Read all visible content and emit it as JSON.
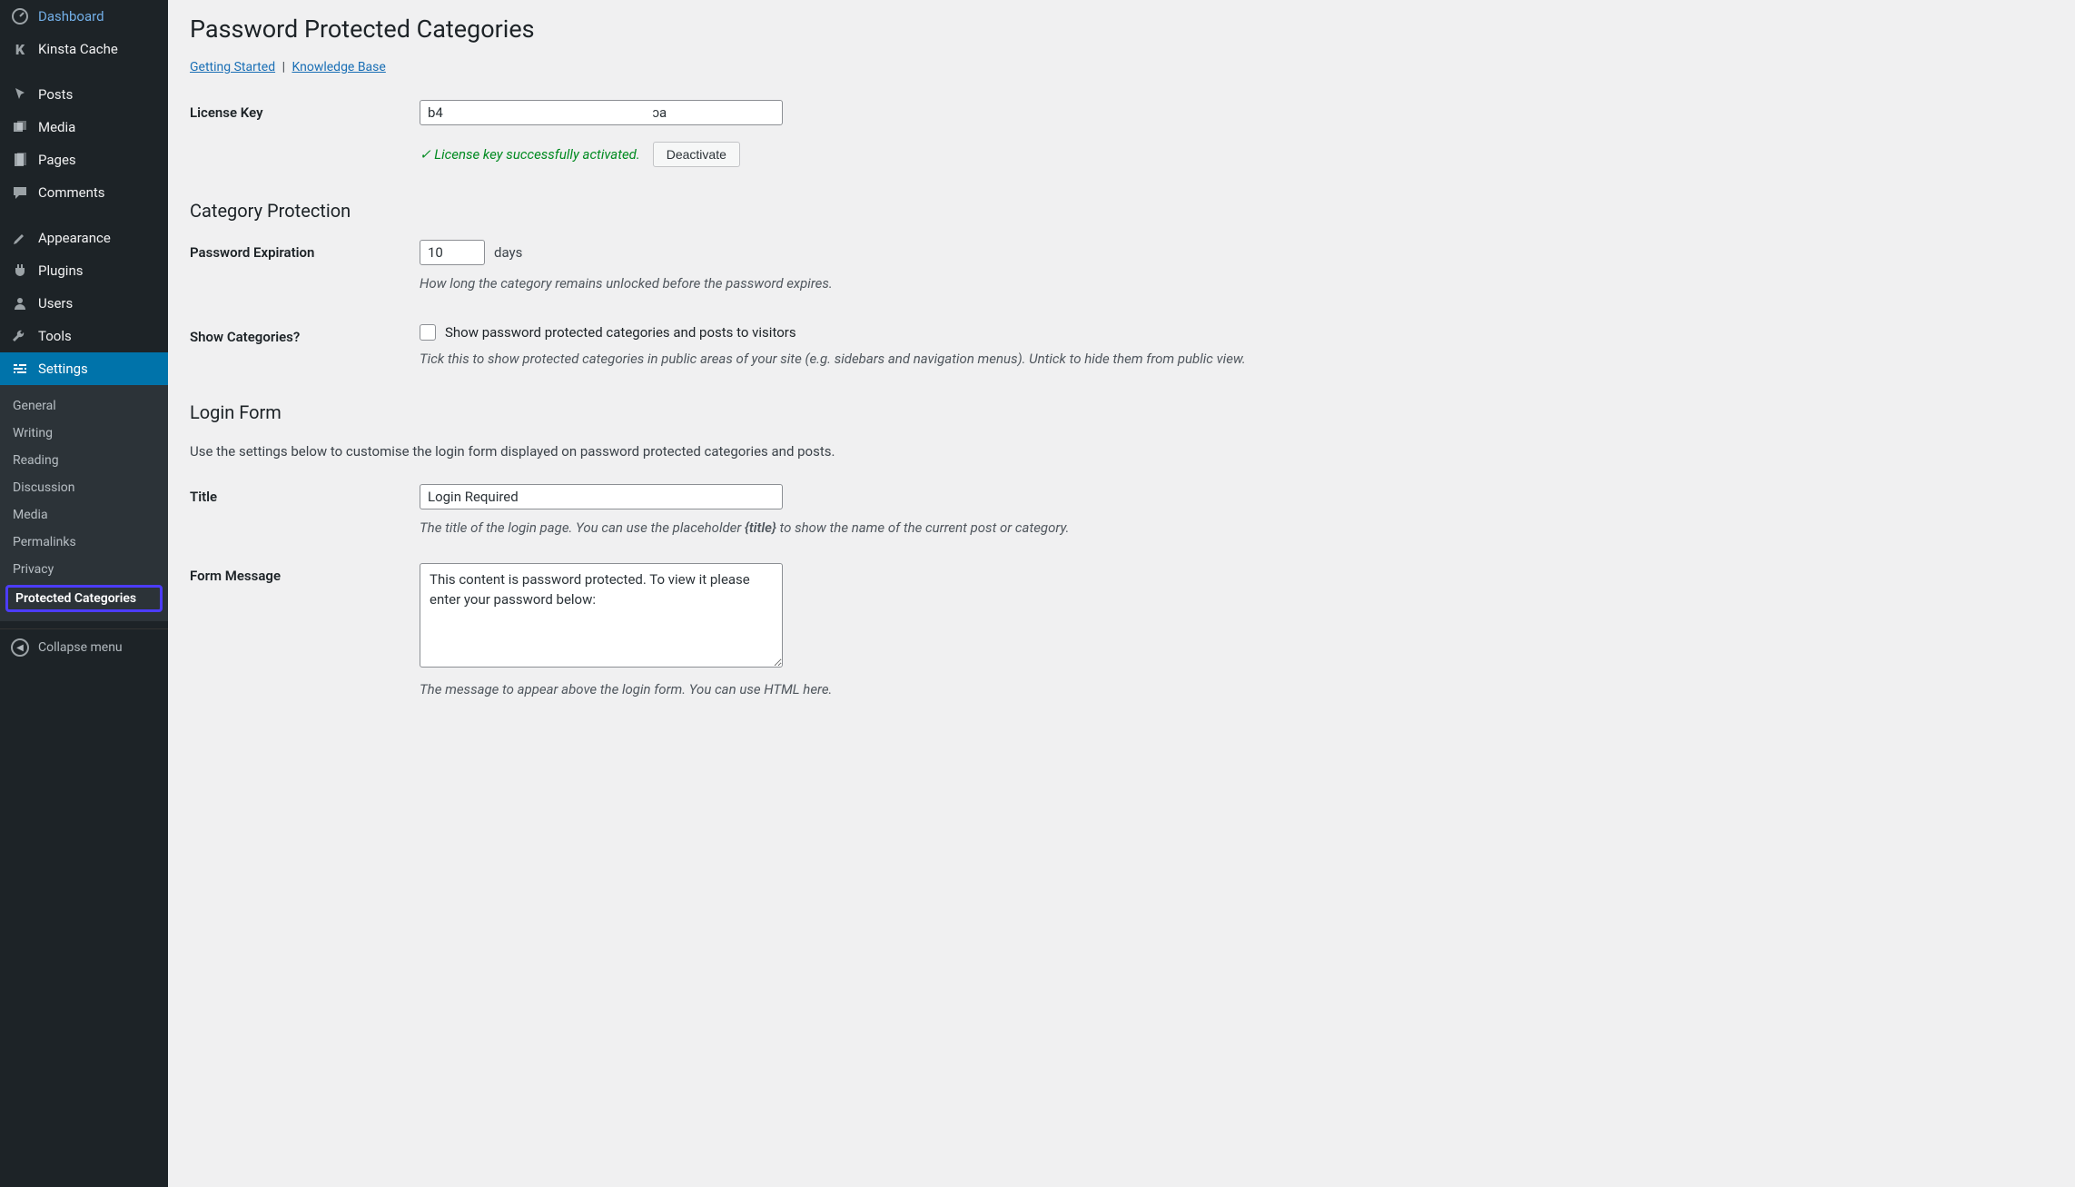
{
  "sidebar": {
    "items": [
      {
        "label": "Dashboard"
      },
      {
        "label": "Kinsta Cache"
      },
      {
        "label": "Posts"
      },
      {
        "label": "Media"
      },
      {
        "label": "Pages"
      },
      {
        "label": "Comments"
      },
      {
        "label": "Appearance"
      },
      {
        "label": "Plugins"
      },
      {
        "label": "Users"
      },
      {
        "label": "Tools"
      },
      {
        "label": "Settings"
      }
    ],
    "submenu": [
      {
        "label": "General"
      },
      {
        "label": "Writing"
      },
      {
        "label": "Reading"
      },
      {
        "label": "Discussion"
      },
      {
        "label": "Media"
      },
      {
        "label": "Permalinks"
      },
      {
        "label": "Privacy"
      },
      {
        "label": "Protected Categories"
      }
    ],
    "collapse": "Collapse menu"
  },
  "page": {
    "title": "Password Protected Categories",
    "link_getting_started": "Getting Started",
    "link_kb": "Knowledge Base",
    "link_sep": "|"
  },
  "license": {
    "label": "License Key",
    "value": "b4                                                              ɔa",
    "status": "✓ License key successfully activated.",
    "deactivate": "Deactivate"
  },
  "protection": {
    "heading": "Category Protection",
    "expiration_label": "Password Expiration",
    "expiration_value": "10",
    "expiration_unit": "days",
    "expiration_desc": "How long the category remains unlocked before the password expires.",
    "show_label": "Show Categories?",
    "show_cb_label": "Show password protected categories and posts to visitors",
    "show_desc": "Tick this to show protected categories in public areas of your site (e.g. sidebars and navigation menus). Untick to hide them from public view."
  },
  "login": {
    "heading": "Login Form",
    "intro": "Use the settings below to customise the login form displayed on password protected categories and posts.",
    "title_label": "Title",
    "title_value": "Login Required",
    "title_desc_a": "The title of the login page. You can use the placeholder ",
    "title_desc_ph": "{title}",
    "title_desc_b": " to show the name of the current post or category.",
    "msg_label": "Form Message",
    "msg_value": "This content is password protected. To view it please enter your password below:",
    "msg_desc": "The message to appear above the login form. You can use HTML here."
  }
}
